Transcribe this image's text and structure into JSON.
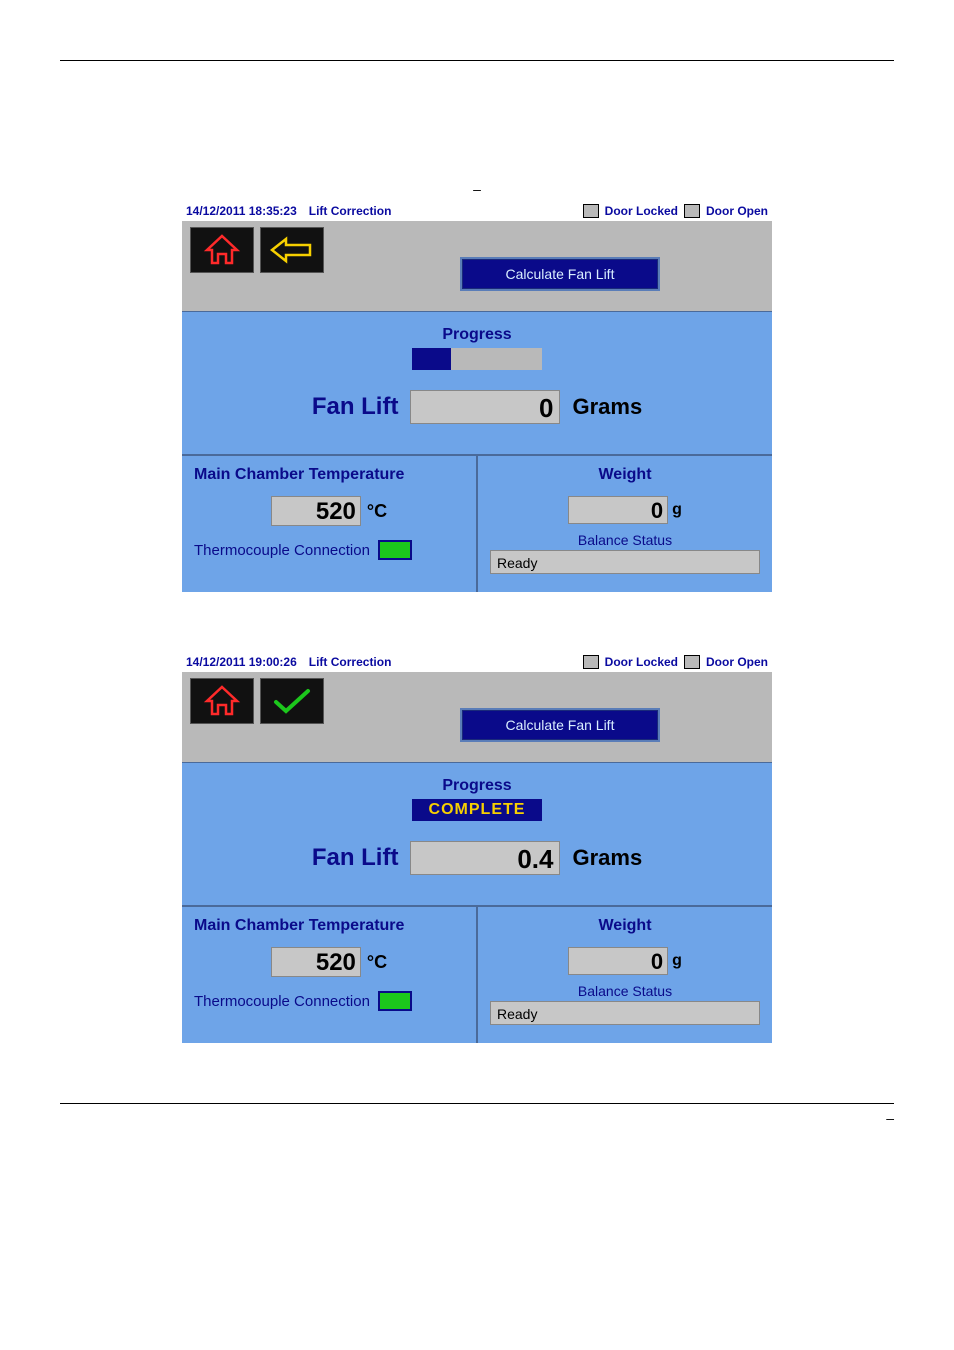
{
  "page": {
    "top_dash": "–",
    "bottom_dash": "–"
  },
  "screens": [
    {
      "status": {
        "timestamp": "14/12/2011 18:35:23",
        "title": "Lift Correction",
        "door_locked": "Door Locked",
        "door_open": "Door Open"
      },
      "toolbar": {
        "home_icon": "home-icon",
        "second_icon": "back-arrow-icon",
        "calc_label": "Calculate Fan Lift"
      },
      "progress": {
        "label": "Progress",
        "complete": "",
        "show_complete": false,
        "fill_pct": 30,
        "fanlift_label": "Fan Lift",
        "fanlift_value": "0",
        "fanlift_unit": "Grams"
      },
      "bottom": {
        "temp_label": "Main Chamber Temperature",
        "temp_value": "520",
        "temp_unit": "°C",
        "tc_label": "Thermocouple Connection",
        "weight_label": "Weight",
        "weight_value": "0",
        "weight_unit": "g",
        "balance_label": "Balance Status",
        "balance_value": "Ready"
      }
    },
    {
      "status": {
        "timestamp": "14/12/2011 19:00:26",
        "title": "Lift Correction",
        "door_locked": "Door Locked",
        "door_open": "Door Open"
      },
      "toolbar": {
        "home_icon": "home-icon",
        "second_icon": "check-icon",
        "calc_label": "Calculate Fan Lift"
      },
      "progress": {
        "label": "Progress",
        "complete": "COMPLETE",
        "show_complete": true,
        "fill_pct": 100,
        "fanlift_label": "Fan Lift",
        "fanlift_value": "0.4",
        "fanlift_unit": "Grams"
      },
      "bottom": {
        "temp_label": "Main Chamber Temperature",
        "temp_value": "520",
        "temp_unit": "°C",
        "tc_label": "Thermocouple Connection",
        "weight_label": "Weight",
        "weight_value": "0",
        "weight_unit": "g",
        "balance_label": "Balance Status",
        "balance_value": "Ready"
      }
    }
  ]
}
